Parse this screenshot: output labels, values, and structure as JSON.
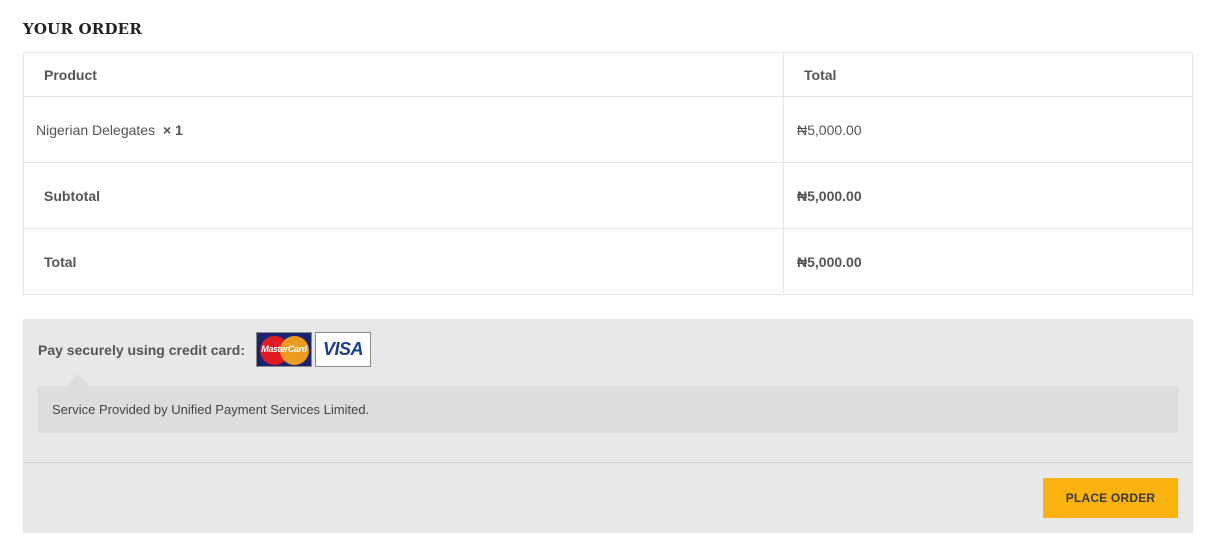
{
  "heading": "YOUR ORDER",
  "table": {
    "headers": {
      "product": "Product",
      "total": "Total"
    },
    "item": {
      "name": "Nigerian Delegates",
      "qty": "× 1",
      "price": "₦5,000.00"
    },
    "subtotal": {
      "label": "Subtotal",
      "value": "₦5,000.00"
    },
    "total": {
      "label": "Total",
      "value": "₦5,000.00"
    }
  },
  "payment": {
    "label": "Pay securely using credit card:",
    "cards": {
      "mastercard": "MasterCard",
      "visa": "VISA"
    },
    "description": "Service Provided by Unified Payment Services Limited.",
    "place_order": "PLACE ORDER"
  },
  "colors": {
    "button": "#fcb20e",
    "panel": "#e9e8e8",
    "info_box": "#dfdcdc"
  }
}
